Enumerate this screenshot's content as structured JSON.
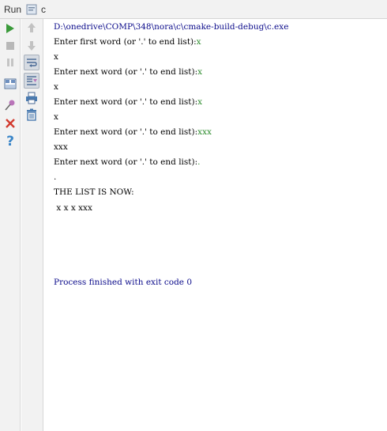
{
  "titlebar": {
    "run_label": "Run",
    "config_label": "c"
  },
  "toolbar": {
    "rerun": "play-icon",
    "stop": "stop-icon",
    "pause": "pause-icon",
    "layout": "layout-icon",
    "pin": "pin-icon",
    "close": "close-icon",
    "help": "help-icon",
    "up": "arrow-up-icon",
    "down": "arrow-down-icon",
    "soft_wrap": "soft-wrap-icon",
    "scroll_end": "scroll-to-end-icon",
    "print": "print-icon",
    "clear": "trash-icon"
  },
  "colors": {
    "path": "#0a0a8a",
    "user_input": "#2a8a2a",
    "toolbar_bg": "#f2f2f2"
  },
  "console": {
    "path": "D:\\onedrive\\COMP\\348\\nora\\c\\cmake-build-debug\\c.exe",
    "lines": [
      {
        "prompt": "Enter first word (or '.' to end list):",
        "input": "x"
      },
      {
        "echo": "x"
      },
      {
        "prompt": "Enter next word (or '.' to end list):",
        "input": "x"
      },
      {
        "echo": "x"
      },
      {
        "prompt": "Enter next word (or '.' to end list):",
        "input": "x"
      },
      {
        "echo": "x"
      },
      {
        "prompt": "Enter next word (or '.' to end list):",
        "input": "xxx"
      },
      {
        "echo": "xxx"
      },
      {
        "prompt": "Enter next word (or '.' to end list):",
        "input": "."
      },
      {
        "echo": "."
      }
    ],
    "list_header": "THE LIST IS NOW:",
    "list_items": " x x x xxx",
    "finish": "Process finished with exit code 0"
  }
}
